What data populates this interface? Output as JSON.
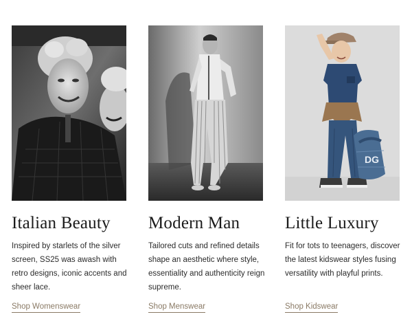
{
  "cards": [
    {
      "title": "Italian Beauty",
      "description": "Inspired by starlets of the silver screen, SS25 was awash with retro designs, iconic accents and sheer lace.",
      "link": "Shop Womenswear",
      "image_icon": "womenswear-photo"
    },
    {
      "title": "Modern Man",
      "description": "Tailored cuts and refined details shape an aesthetic where style, essentiality and authenticity reign supreme.",
      "link": "Shop Menswear",
      "image_icon": "menswear-photo"
    },
    {
      "title": "Little Luxury",
      "description": "Fit for tots to teenagers, discover the latest kidswear styles fusing versatility with playful prints.",
      "link": "Shop Kidswear",
      "image_icon": "kidswear-photo"
    }
  ],
  "colors": {
    "link": "#8a7a65",
    "text": "#2b2b2b",
    "title": "#1b1b1b"
  }
}
